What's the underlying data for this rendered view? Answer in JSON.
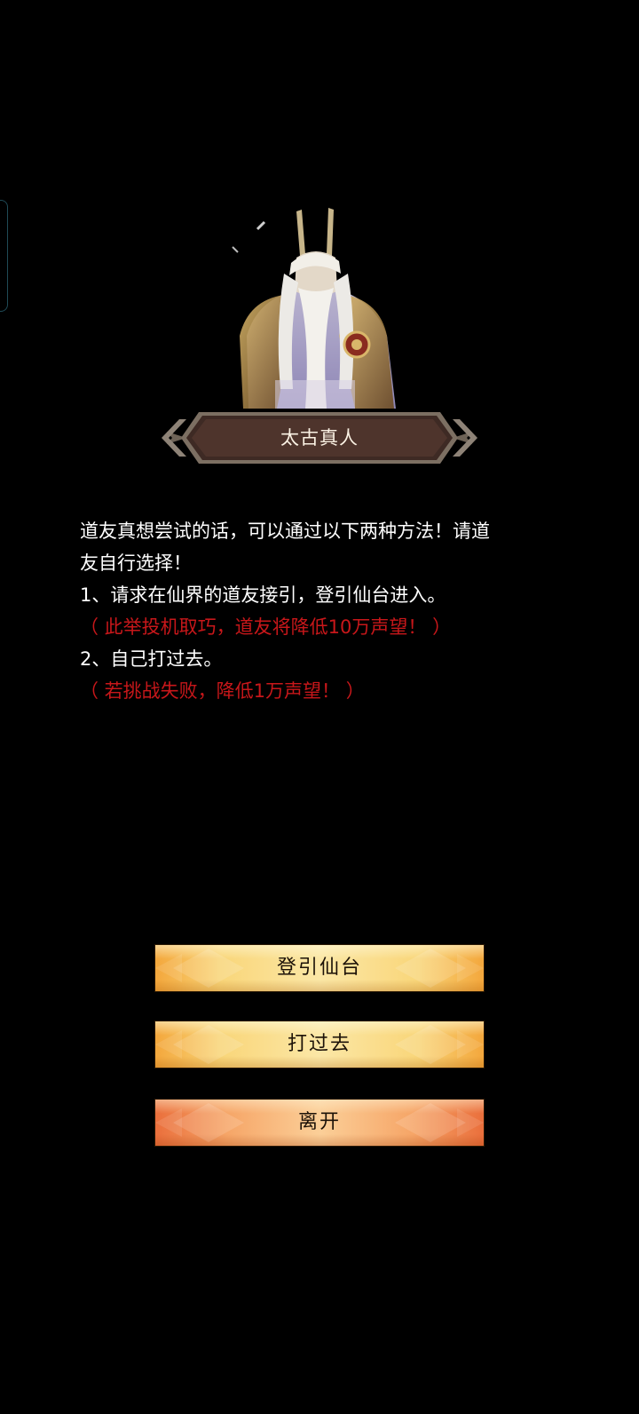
{
  "npc": {
    "name": "太古真人",
    "portrait_icon": "immortal-sage-portrait"
  },
  "dialog": {
    "lines": [
      {
        "text": "道友真想尝试的话，可以通过以下两种方法！请道",
        "color": "#ffffff"
      },
      {
        "text": "友自行选择！",
        "color": "#ffffff"
      },
      {
        "text": "1、请求在仙界的道友接引，登引仙台进入。",
        "color": "#ffffff"
      },
      {
        "text": "（ 此举投机取巧，道友将降低10万声望！ ）",
        "color": "#c8171a"
      },
      {
        "text": "2、自己打过去。",
        "color": "#ffffff"
      },
      {
        "text": "（ 若挑战失败，降低1万声望！ ）",
        "color": "#c8171a"
      }
    ]
  },
  "buttons": {
    "ascend_label": "登引仙台",
    "fight_label": "打过去",
    "leave_label": "离开"
  },
  "colors": {
    "background": "#000000",
    "warning_text": "#c8171a",
    "button_gold": "#f9d67a",
    "button_orange": "#f6a668",
    "nameplate": "#4a2f28"
  }
}
